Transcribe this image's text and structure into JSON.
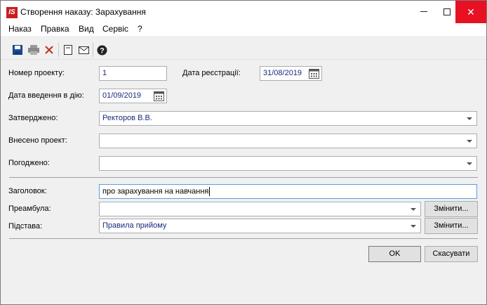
{
  "window": {
    "title": "Створення наказу: Зарахування",
    "logo_text": "IS"
  },
  "menu": {
    "items": [
      "Наказ",
      "Правка",
      "Вид",
      "Сервіс",
      "?"
    ]
  },
  "toolbar": {
    "icons": [
      "save-icon",
      "print-icon",
      "delete-icon",
      "document-icon",
      "mail-icon",
      "help-icon"
    ]
  },
  "form": {
    "project_number_label": "Номер проекту:",
    "project_number_value": "1",
    "registration_date_label": "Дата реєстрації:",
    "registration_date_value": "31/08/2019",
    "effective_date_label": "Дата введення в дію:",
    "effective_date_value": "01/09/2019",
    "approved_label": "Затверджено:",
    "approved_value": "Ректоров В.В.",
    "submitted_label": "Внесено проект:",
    "submitted_value": "",
    "agreed_label": "Погоджено:",
    "agreed_value": "",
    "heading_label": "Заголовок:",
    "heading_value": "про зарахування на навчання",
    "preamble_label": "Преамбула:",
    "preamble_value": "",
    "preamble_change_label": "Змінити...",
    "basis_label": "Підстава:",
    "basis_value": "Правила прийому",
    "basis_change_label": "Змінити..."
  },
  "footer": {
    "ok_label": "OK",
    "cancel_label": "Скасувати"
  }
}
